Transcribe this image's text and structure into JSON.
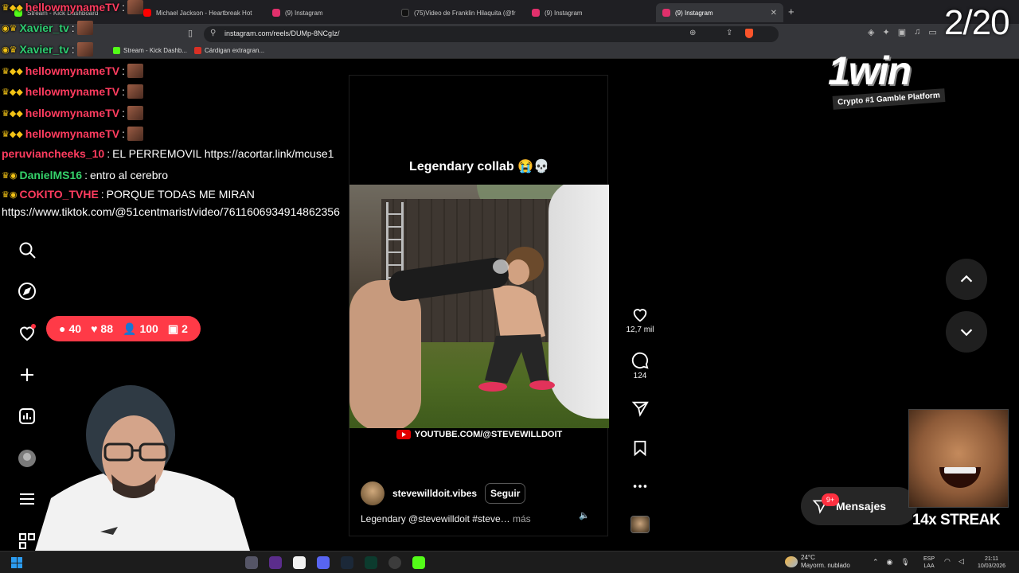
{
  "browser": {
    "tabs": [
      {
        "title": "Stream - Kick Dashboard",
        "color": "#53fc18"
      },
      {
        "title": "Michael Jackson - Heartbreak Hot",
        "color": "#ff0000"
      },
      {
        "title": "(9) Instagram",
        "color": "#e1306c"
      },
      {
        "title": "(75)Video de Franklin Hilaquita (@fr",
        "color": "#111111"
      },
      {
        "title": "(9) Instagram",
        "color": "#e1306c"
      },
      {
        "title": "(9) Instagram",
        "color": "#e1306c"
      }
    ],
    "active_tab_index": 5,
    "new_tab": "+",
    "url": "instagram.com/reels/DUMp-8NCgIz/",
    "bookmarks": [
      {
        "label": "Stream - Kick Dashb...",
        "color": "#53fc18"
      },
      {
        "label": "Cárdigan extragran...",
        "color": "#d93025"
      }
    ]
  },
  "chat": [
    {
      "user": "hellowmynameTV",
      "user_color": "#ff3c5f",
      "message": ""
    },
    {
      "user": "Xavier_tv",
      "user_color": "#2ecc71",
      "message": ""
    },
    {
      "user": "Xavier_tv",
      "user_color": "#2ecc71",
      "message": ""
    },
    {
      "user": "hellowmynameTV",
      "user_color": "#ff3c5f",
      "message": ""
    },
    {
      "user": "hellowmynameTV",
      "user_color": "#ff3c5f",
      "message": ""
    },
    {
      "user": "hellowmynameTV",
      "user_color": "#ff3c5f",
      "message": ""
    },
    {
      "user": "hellowmynameTV",
      "user_color": "#ff3c5f",
      "message": ""
    },
    {
      "user": "peruviancheeks_10",
      "user_color": "#ff3c5f",
      "message": "EL PERREMOVIL  https://acortar.link/mcuse1"
    },
    {
      "user": "DanielMS16",
      "user_color": "#35d16a",
      "message": "entro al cerebro"
    },
    {
      "user": "COKITO_TVHE",
      "user_color": "#ff3c5f",
      "message": "PORQUE TODAS ME MIRAN"
    },
    {
      "user": "",
      "user_color": "#ffffff",
      "message": "https://www.tiktok.com/@51centmarist/video/7611606934914862356"
    }
  ],
  "stats_pill": {
    "chats": "40",
    "likes": "88",
    "viewers": "100",
    "followers": "2"
  },
  "counter": "2/20",
  "brand": {
    "logo": "1win",
    "tagline": "Crypto #1 Gamble Platform"
  },
  "reel": {
    "overlay_caption": "Legendary collab 😭💀",
    "watermark": "YOUTUBE.COM/@STEVEWILLDOIT",
    "author": "stevewilldoit.vibes",
    "follow_label": "Seguir",
    "description": "Legendary @stevewilldoit #steve…",
    "more_label": "más",
    "likes": "12,7 mil",
    "comments": "124"
  },
  "messages": {
    "label": "Mensajes",
    "badge": "9+"
  },
  "streak": "14x STREAK",
  "taskbar": {
    "weather_temp": "24°C",
    "weather_desc": "Mayorm. nublado",
    "lang_1": "ESP",
    "lang_2": "LAA",
    "time": "21:11",
    "date": "10/03/2026"
  }
}
